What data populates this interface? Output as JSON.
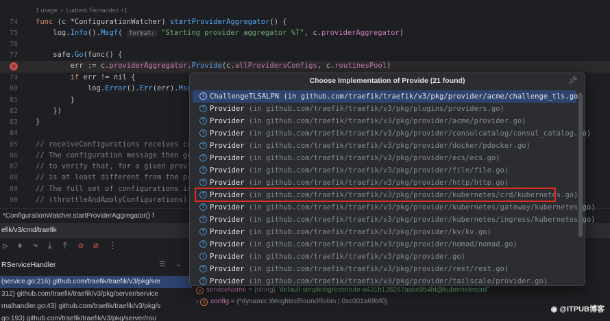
{
  "editor": {
    "usage_hint": "1 usage   ⚬ Ludovic Fernandez +1",
    "line_numbers": [
      "74",
      "75",
      "76",
      "77",
      "78",
      "79",
      "80",
      "81",
      "82",
      "83",
      "84",
      "85",
      "86",
      "87",
      "88",
      "89",
      "90"
    ],
    "lines": {
      "l74_a": "func ",
      "l74_b": "(c *ConfigurationWatcher) ",
      "l74_c": "startProviderAggregator",
      "l74_d": "() {",
      "l75_a": "    log.",
      "l75_b": "Info",
      "l75_c": "().",
      "l75_d": "Msgf",
      "l75_e": "( ",
      "l75_hint": "format:",
      "l75_str": " \"Starting provider aggregator %T\"",
      "l75_f": ", c.",
      "l75_g": "providerAggregator",
      "l75_h": ")",
      "l77_a": "    safe.",
      "l77_b": "Go",
      "l77_c": "(func() {",
      "l78_a": "        err := c.",
      "l78_b": "providerAggregator",
      "l78_c": ".",
      "l78_d": "Provide",
      "l78_e": "(c.",
      "l78_f": "allProvidersConfigs",
      "l78_g": ", c.",
      "l78_h": "routinesPool",
      "l78_i": ")",
      "l79_a": "        if ",
      "l79_b": "err != nil {",
      "l80_a": "            log.",
      "l80_b": "Error",
      "l80_c": "().",
      "l80_d": "Err",
      "l80_e": "(err).",
      "l80_f": "Msgf",
      "l80_g": "(",
      "l81": "        }",
      "l82": "    })",
      "l83": "}",
      "l85": "// receiveConfigurations receives configu",
      "l86": "// The configuration message then gets p",
      "l87": "// to verify that, for a given provider",
      "l88": "// is at least different from the previ",
      "l89": "// The full set of configurations is the",
      "l90": "// (throttleAndApplyConfigurations) via"
    }
  },
  "breadcrumb": "*ConfigurationWatcher.startProviderAggregator()   f",
  "debug": {
    "tab_label": "efik/v3/cmd/traefik",
    "frames_header": "RServiceHandler",
    "frames": [
      "(service.go:216) github.com/traefik/traefik/v3/pkg/ser",
      "312) github.com/traefik/traefik/v3/pkg/server/service",
      "rnalhandler.go:43) github.com/traefik/traefik/v3/pkg/s",
      "go:193) github.com/traefik/traefik/v3/pkg/server/rou"
    ],
    "variables": [
      {
        "name": "serviceName",
        "type": " = {string} ",
        "value": "\"default-simpleingressroute-a431b128267aabc954fd@kubernetescrd\"",
        "badge": "p"
      },
      {
        "name": "config",
        "type": " = {*dynamic.WeightedRoundRobin | 0xc001a69bf0}",
        "value": "",
        "badge": "p"
      }
    ]
  },
  "popup": {
    "title": "Choose Implementation of Provide (21 found)",
    "items": [
      {
        "name": "ChallengeTLSALPN",
        "location": " (in github.com/traefik/traefik/v3/pkg/provider/acme/challenge_tls.go)"
      },
      {
        "name": "Provider",
        "location": " (in github.com/traefik/traefik/v3/pkg/plugins/providers.go)"
      },
      {
        "name": "Provider",
        "location": " (in github.com/traefik/traefik/v3/pkg/provider/acme/provider.go)"
      },
      {
        "name": "Provider",
        "location": " (in github.com/traefik/traefik/v3/pkg/provider/consulcatalog/consul_catalog.go)"
      },
      {
        "name": "Provider",
        "location": " (in github.com/traefik/traefik/v3/pkg/provider/docker/pdocker.go)"
      },
      {
        "name": "Provider",
        "location": " (in github.com/traefik/traefik/v3/pkg/provider/ecs/ecs.go)"
      },
      {
        "name": "Provider",
        "location": " (in github.com/traefik/traefik/v3/pkg/provider/file/file.go)"
      },
      {
        "name": "Provider",
        "location": " (in github.com/traefik/traefik/v3/pkg/provider/http/http.go)"
      },
      {
        "name": "Provider",
        "location": " (in github.com/traefik/traefik/v3/pkg/provider/kubernetes/crd/kubernetes.go)"
      },
      {
        "name": "Provider",
        "location": " (in github.com/traefik/traefik/v3/pkg/provider/kubernetes/gateway/kubernetes.go)"
      },
      {
        "name": "Provider",
        "location": " (in github.com/traefik/traefik/v3/pkg/provider/kubernetes/ingress/kubernetes.go)"
      },
      {
        "name": "Provider",
        "location": " (in github.com/traefik/traefik/v3/pkg/provider/kv/kv.go)"
      },
      {
        "name": "Provider",
        "location": " (in github.com/traefik/traefik/v3/pkg/provider/nomad/nomad.go)"
      },
      {
        "name": "Provider",
        "location": " (in github.com/traefik/traefik/v3/pkg/provider.go)"
      },
      {
        "name": "Provider",
        "location": " (in github.com/traefik/traefik/v3/pkg/provider/rest/rest.go)"
      },
      {
        "name": "Provider",
        "location": " (in github.com/traefik/traefik/v3/pkg/provider/tailscale/provider.go)"
      }
    ],
    "icon_letters": [
      "I",
      "T",
      "T",
      "T",
      "T",
      "T",
      "T",
      "T",
      "T",
      "T",
      "T",
      "T",
      "T",
      "I",
      "T",
      "T"
    ]
  },
  "watermark": "@ITPUB博客",
  "colors": {
    "background": "#1e1f22",
    "popup": "#2b2d30",
    "selection": "#2e436e",
    "highlight_box": "#d93025"
  }
}
